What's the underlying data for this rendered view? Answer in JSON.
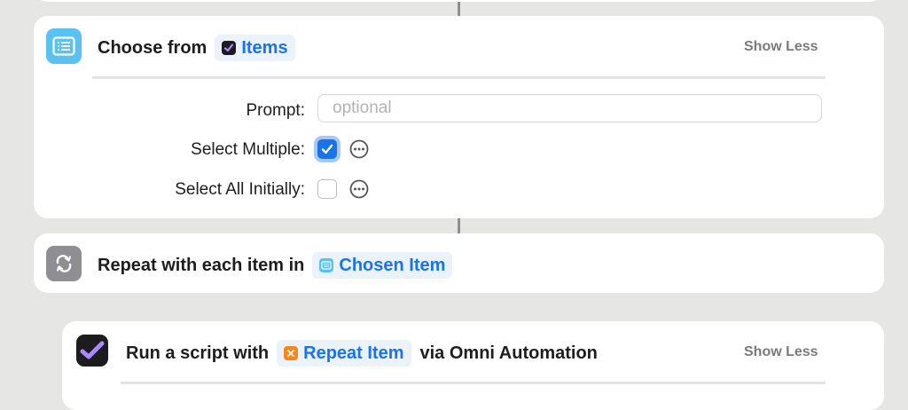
{
  "colors": {
    "accent": "#1a73e8",
    "token_bg": "#eaf2fb",
    "card_bg": "#ffffff",
    "canvas_bg": "#e6e6e5",
    "choose_icon_bg": "#5ac2f0",
    "repeat_icon_bg": "#8e8e93",
    "omni_icon_bg": "#1c1c1e",
    "repeat_item_bg": "#f5871f"
  },
  "choose_action": {
    "icon": "list-icon",
    "title": "Choose from",
    "token_icon": "omnifocus-check-icon",
    "token_label": "Items",
    "show_less_label": "Show Less",
    "prompt_label": "Prompt:",
    "prompt_value": "",
    "prompt_placeholder": "optional",
    "select_multiple_label": "Select Multiple:",
    "select_multiple_checked": true,
    "select_all_label": "Select All Initially:",
    "select_all_checked": false,
    "more_icon": "ellipsis-circle-icon"
  },
  "repeat_action": {
    "icon": "repeat-icon",
    "title": "Repeat with each item in",
    "token_icon": "list-icon",
    "token_label": "Chosen Item"
  },
  "run_script_action": {
    "icon": "omnifocus-check-icon",
    "title": "Run a script with",
    "token_icon": "variable-x-icon",
    "token_label": "Repeat Item",
    "suffix": "via Omni Automation",
    "show_less_label": "Show Less"
  }
}
